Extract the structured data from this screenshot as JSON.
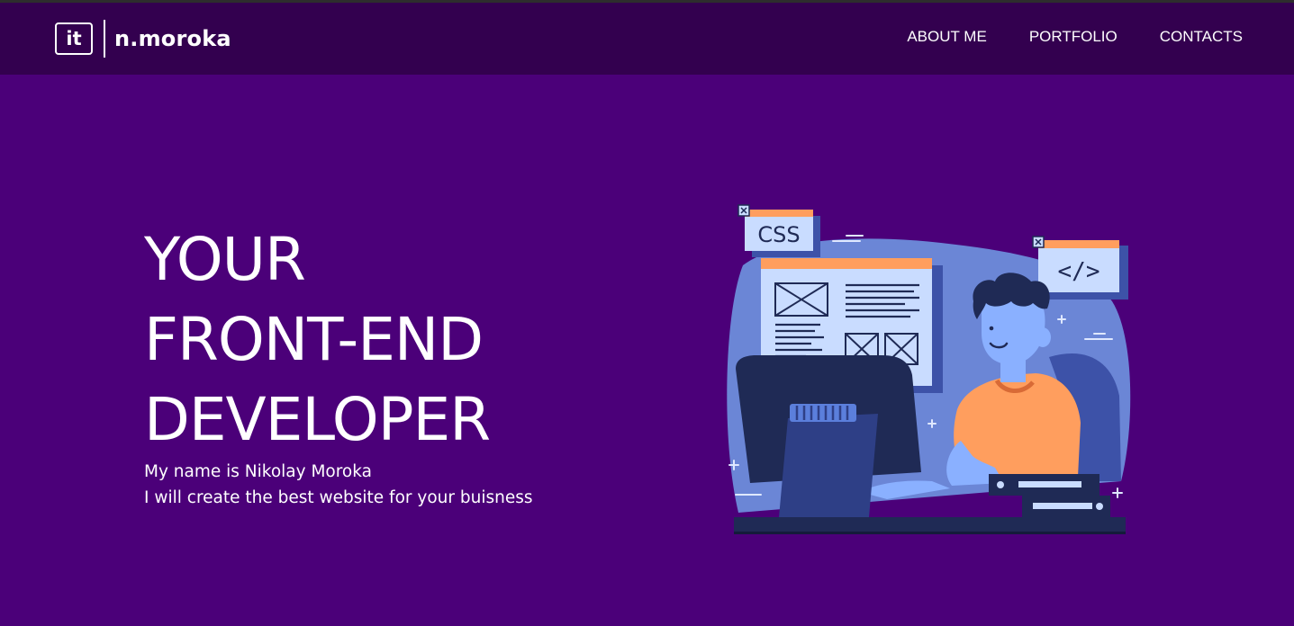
{
  "header": {
    "logo": {
      "badge": "it",
      "name": "n.moroka"
    },
    "nav": [
      {
        "label": "ABOUT ME"
      },
      {
        "label": "PORTFOLIO"
      },
      {
        "label": "CONTACTS"
      }
    ]
  },
  "hero": {
    "title_lines": [
      "YOUR",
      "FRONT-END",
      "DEVELOPER"
    ],
    "subtitle_lines": [
      "My name is Nikolay Moroka",
      "I will create the best website for your buisness"
    ]
  },
  "illustration": {
    "css_label": "CSS",
    "code_label": "</>"
  },
  "colors": {
    "background": "#4b0079",
    "header": "#33004f",
    "text": "#ffffff",
    "accent": "#ff9e5e",
    "blob": "#6b86d6"
  }
}
